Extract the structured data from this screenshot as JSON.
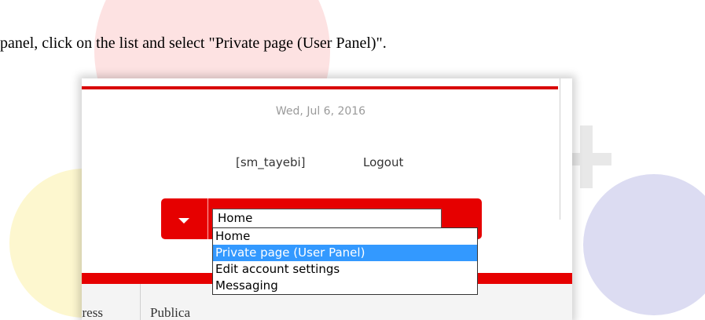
{
  "instruction": "panel, click on the list and select \"Private page (User Panel)\".",
  "header": {
    "date": "Wed, Jul 6, 2016",
    "username": "[sm_tayebi]",
    "logout_label": "Logout"
  },
  "nav": {
    "selected_value": "Home",
    "options": [
      "Home",
      "Private page (User Panel)",
      "Edit account settings",
      "Messaging"
    ],
    "highlighted_index": 1
  },
  "tabs": {
    "progress_label": "gress",
    "publications_label": "Publica"
  },
  "colors": {
    "accent_red": "#e60000",
    "highlight_blue": "#3399ff"
  }
}
